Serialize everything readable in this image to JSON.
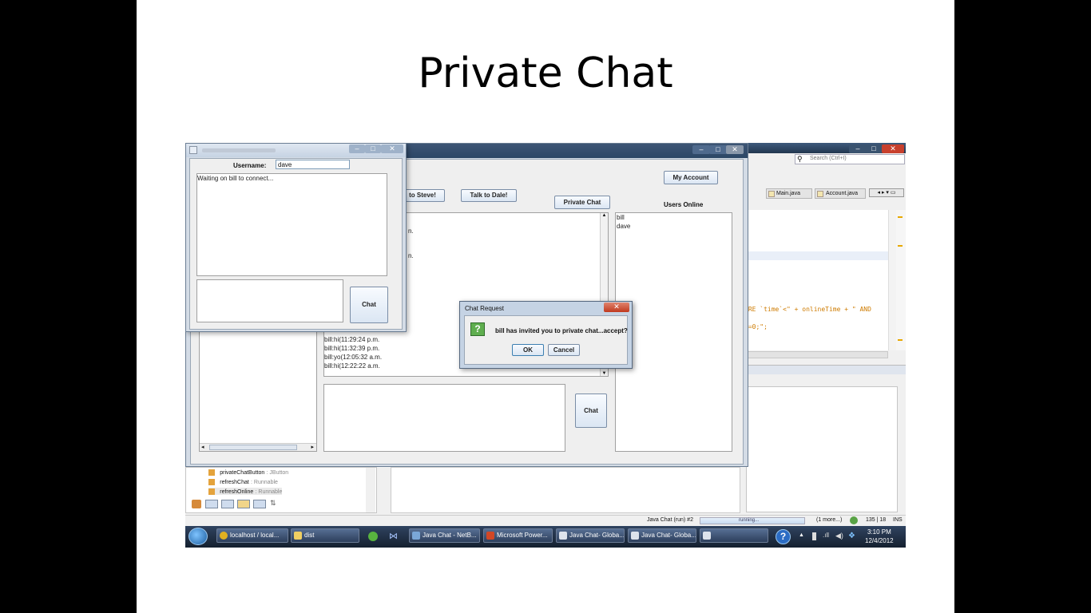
{
  "slide": {
    "title": "Private Chat"
  },
  "netbeans": {
    "search_placeholder": "Search (Ctrl+I)",
    "tabs": [
      "Main.java",
      "Account.java"
    ],
    "code": {
      "line1": "ERE `time`<\" + onlineTime + \" AND",
      "line2": "`=0;\";"
    },
    "navigator": [
      {
        "name": "privateChatButton",
        "type": ": JButton"
      },
      {
        "name": "refreshChat",
        "type": ": Runnable"
      },
      {
        "name": "refreshOnline",
        "type": ": Runnable"
      }
    ],
    "status": {
      "run_label": "Java Chat (run) #2",
      "progress_label": "running...",
      "more": "(1 more...)",
      "position": "135 | 18",
      "mode": "INS"
    }
  },
  "global_chat": {
    "my_account": "My Account",
    "talk_steve": "to Steve!",
    "talk_dale": "Talk to Dale!",
    "private_chat": "Private Chat",
    "users_online_label": "Users Online",
    "users_online": [
      "bill",
      "dave"
    ],
    "messages_partial": [
      "n.",
      "n."
    ],
    "messages": [
      "bill:hi(11:29:24 p.m.",
      "bill:hi(11:32:39 p.m.",
      "bill:yo(12:05:32 a.m.",
      "bill:hi(12:22:22 a.m."
    ],
    "chat_button": "Chat"
  },
  "private_chat": {
    "username_label": "Username:",
    "username_value": "dave",
    "status_text": "Waiting on bill to connect...",
    "chat_button": "Chat"
  },
  "dialog": {
    "title": "Chat Request",
    "message": "bill has invited you to private chat...accept?",
    "ok": "OK",
    "cancel": "Cancel"
  },
  "taskbar": {
    "items": [
      "localhost / local...",
      "dist",
      "Java Chat - NetB...",
      "Microsoft Power...",
      "Java Chat- Globa...",
      "Java Chat- Globa..."
    ],
    "time": "3:10 PM",
    "date": "12/4/2012"
  },
  "colors": {
    "titlebar": "#2c4766",
    "close": "#c8402d",
    "taskbar": "#1f2d43"
  }
}
